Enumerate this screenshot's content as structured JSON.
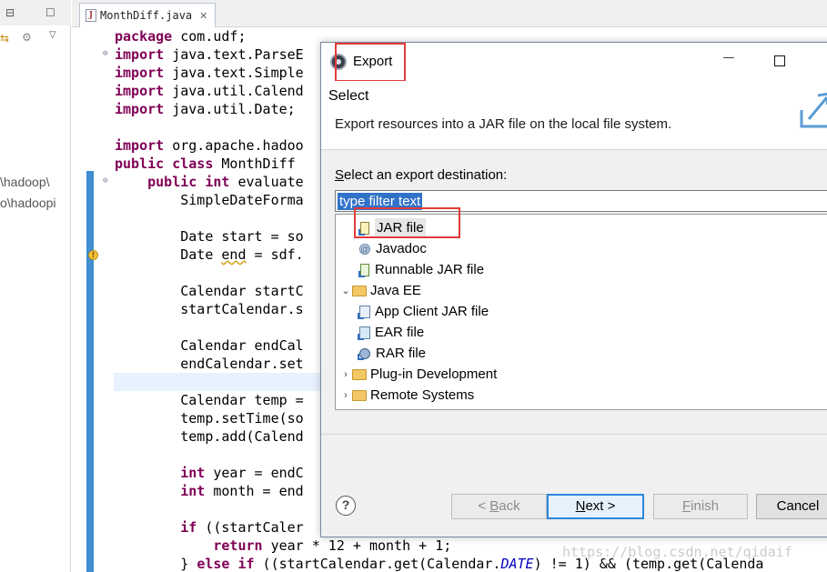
{
  "left_panel": {
    "lines": [
      "\\hadoop\\",
      "o\\hadoopi"
    ]
  },
  "editor_tab": {
    "label": "MonthDiff.java",
    "close": "✕"
  },
  "code_lines": [
    {
      "parts": [
        [
          "kw",
          "package"
        ],
        [
          "t",
          " com.udf;"
        ]
      ]
    },
    {
      "parts": [
        [
          "kw",
          "import"
        ],
        [
          "t",
          " java.text.ParseE"
        ]
      ]
    },
    {
      "parts": [
        [
          "kw",
          "import"
        ],
        [
          "t",
          " java.text.Simple"
        ]
      ]
    },
    {
      "parts": [
        [
          "kw",
          "import"
        ],
        [
          "t",
          " java.util.Calend"
        ]
      ]
    },
    {
      "parts": [
        [
          "kw",
          "import"
        ],
        [
          "t",
          " java.util.Date;"
        ]
      ]
    },
    {
      "parts": []
    },
    {
      "parts": [
        [
          "kw",
          "import"
        ],
        [
          "t",
          " org.apache.hadoo"
        ]
      ]
    },
    {
      "parts": [
        [
          "kw",
          "public class"
        ],
        [
          "t",
          " MonthDiff"
        ]
      ]
    },
    {
      "parts": [
        [
          "t",
          "    "
        ],
        [
          "kw",
          "public int"
        ],
        [
          "t",
          " evaluate"
        ]
      ]
    },
    {
      "parts": [
        [
          "t",
          "        SimpleDateForma"
        ]
      ]
    },
    {
      "parts": []
    },
    {
      "parts": [
        [
          "t",
          "        Date start = so"
        ]
      ]
    },
    {
      "parts": [
        [
          "t",
          "        Date "
        ],
        [
          "warn",
          "end"
        ],
        [
          "t",
          " = sdf."
        ]
      ]
    },
    {
      "parts": []
    },
    {
      "parts": [
        [
          "t",
          "        Calendar startC"
        ]
      ]
    },
    {
      "parts": [
        [
          "t",
          "        startCalendar.s"
        ]
      ]
    },
    {
      "parts": []
    },
    {
      "parts": [
        [
          "t",
          "        Calendar endCal"
        ]
      ]
    },
    {
      "parts": [
        [
          "t",
          "        endCalendar.set"
        ]
      ]
    },
    {
      "parts": []
    },
    {
      "parts": [
        [
          "t",
          "        Calendar temp ="
        ]
      ]
    },
    {
      "parts": [
        [
          "t",
          "        temp.setTime(so"
        ]
      ]
    },
    {
      "parts": [
        [
          "t",
          "        temp.add(Calend"
        ]
      ]
    },
    {
      "parts": []
    },
    {
      "parts": [
        [
          "t",
          "        "
        ],
        [
          "kw",
          "int"
        ],
        [
          "t",
          " year = endC"
        ]
      ]
    },
    {
      "parts": [
        [
          "t",
          "        "
        ],
        [
          "kw",
          "int"
        ],
        [
          "t",
          " month = end"
        ]
      ]
    },
    {
      "parts": []
    },
    {
      "parts": [
        [
          "t",
          "        "
        ],
        [
          "kw",
          "if"
        ],
        [
          "t",
          " ((startCaler"
        ]
      ]
    },
    {
      "parts": [
        [
          "t",
          "            "
        ],
        [
          "kw",
          "return"
        ],
        [
          "t",
          " year * 12 + month + 1;"
        ]
      ]
    },
    {
      "parts": [
        [
          "t",
          "        } "
        ],
        [
          "kw",
          "else if"
        ],
        [
          "t",
          " ((startCalendar.get(Calendar."
        ],
        [
          "it",
          "DATE"
        ],
        [
          "t",
          ") != 1) && (temp.get(Calenda"
        ]
      ]
    }
  ],
  "dialog": {
    "title": "Export",
    "minimize_symbol": "—",
    "heading": "Select",
    "description": "Export resources into a JAR file on the local file system.",
    "dest_label_pre": "",
    "dest_label_mnemonic": "S",
    "dest_label_post": "elect an export destination:",
    "filter_value": "type filter text",
    "tree": [
      {
        "label": "JAR file",
        "indent": 2,
        "icon": "jar-file-icon",
        "twisty": "",
        "selected": true
      },
      {
        "label": "Javadoc",
        "indent": 2,
        "icon": "javadoc-icon",
        "twisty": "",
        "selected": false
      },
      {
        "label": "Runnable JAR file",
        "indent": 2,
        "icon": "runnable-jar-icon",
        "twisty": "",
        "selected": false
      },
      {
        "label": "Java EE",
        "indent": 1,
        "icon": "folder-icon",
        "twisty": "expanded",
        "selected": false
      },
      {
        "label": "App Client JAR file",
        "indent": 2,
        "icon": "app-client-jar-icon",
        "twisty": "",
        "selected": false
      },
      {
        "label": "EAR file",
        "indent": 2,
        "icon": "ear-file-icon",
        "twisty": "",
        "selected": false
      },
      {
        "label": "RAR file",
        "indent": 2,
        "icon": "rar-file-icon",
        "twisty": "",
        "selected": false
      },
      {
        "label": "Plug-in Development",
        "indent": 1,
        "icon": "folder-icon",
        "twisty": "collapsed",
        "selected": false
      },
      {
        "label": "Remote Systems",
        "indent": 1,
        "icon": "folder-icon",
        "twisty": "collapsed",
        "selected": false
      }
    ],
    "help_symbol": "?",
    "buttons": {
      "back_pre": "< ",
      "back_mn": "B",
      "back_post": "ack",
      "next_pre": "",
      "next_mn": "N",
      "next_post": "ext >",
      "finish_pre": "",
      "finish_mn": "F",
      "finish_post": "inish",
      "cancel": "Cancel"
    }
  },
  "watermark": "https://blog.csdn.net/qidaif",
  "colors": {
    "keyword": "#7f0055",
    "highlight_box": "#e23a3a",
    "selection": "#3172c9",
    "change_bar": "#3f8fd2"
  }
}
